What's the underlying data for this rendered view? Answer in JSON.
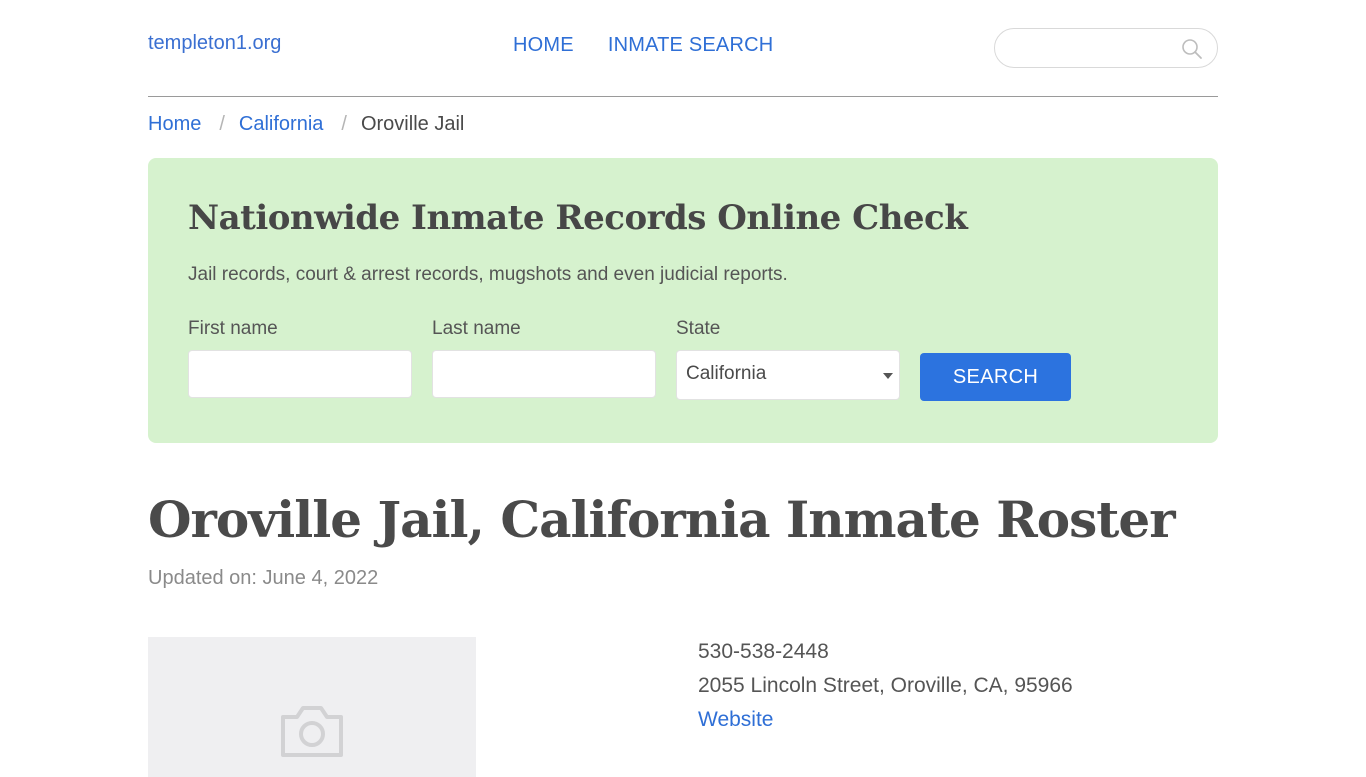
{
  "header": {
    "logo": "templeton1.org",
    "nav": [
      {
        "label": "HOME"
      },
      {
        "label": "INMATE SEARCH"
      }
    ],
    "search": {
      "placeholder": "",
      "value": "",
      "icon": "search-icon"
    }
  },
  "breadcrumb": {
    "items": [
      {
        "label": "Home"
      },
      {
        "label": "California"
      },
      {
        "label": "Oroville Jail"
      }
    ],
    "separator": "/"
  },
  "banner": {
    "title": "Nationwide Inmate Records Online Check",
    "subtitle": "Jail records, court & arrest records, mugshots and even judicial reports.",
    "first_name_label": "First name",
    "first_name_value": "",
    "last_name_label": "Last name",
    "last_name_value": "",
    "state_label": "State",
    "state_selected": "California",
    "search_button": "SEARCH",
    "background_color": "#d6f2ce",
    "button_color": "#2c73df"
  },
  "main": {
    "title": "Oroville Jail, California Inmate Roster",
    "updated": "Updated on: June 4, 2022",
    "image_icon": "camera-icon",
    "contact": {
      "phone": "530-538-2448",
      "address": "2055 Lincoln Street, Oroville, CA, 95966",
      "website_label": "Website"
    }
  },
  "colors": {
    "link": "#2f6fd6",
    "text": "#4a4a4a",
    "muted": "#8a8a8a"
  }
}
